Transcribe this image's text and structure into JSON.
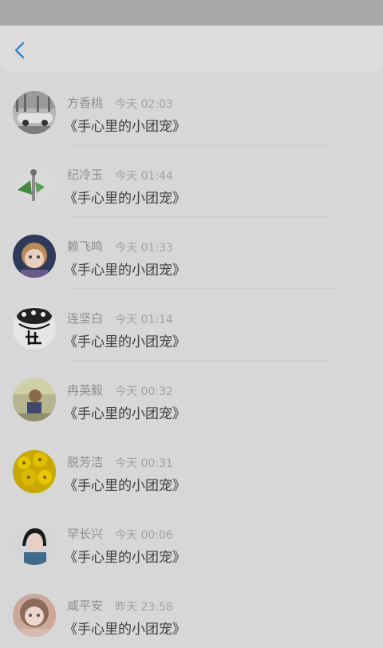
{
  "header": {
    "back_icon": "chevron-left-icon",
    "accent_color": "#3a86c8"
  },
  "rows": [
    {
      "name": "方香桃",
      "time": "今天 02:03",
      "title": "《手心里的小团宠》"
    },
    {
      "name": "纪冷玉",
      "time": "今天 01:44",
      "title": "《手心里的小团宠》"
    },
    {
      "name": "赖飞鸣",
      "time": "今天 01:33",
      "title": "《手心里的小团宠》"
    },
    {
      "name": "连坚白",
      "time": "今天 01:14",
      "title": "《手心里的小团宠》"
    },
    {
      "name": "冉英毅",
      "time": "今天 00:32",
      "title": "《手心里的小团宠》"
    },
    {
      "name": "脱芳洁",
      "time": "今天 00:31",
      "title": "《手心里的小团宠》"
    },
    {
      "name": "罕长兴",
      "time": "今天 00:06",
      "title": "《手心里的小团宠》"
    },
    {
      "name": "咸平安",
      "time": "昨天 23:58",
      "title": "《手心里的小团宠》"
    }
  ]
}
